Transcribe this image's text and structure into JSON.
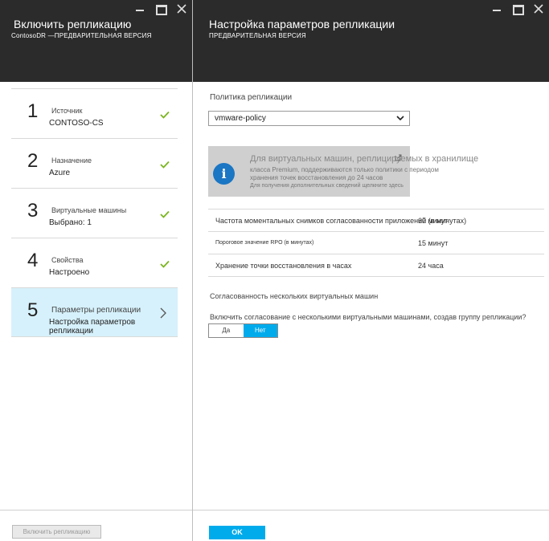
{
  "left_blade": {
    "title": "Включить репликацию",
    "subtitle": "ContosoDR —ПРЕДВАРИТЕЛЬНАЯ ВЕРСИЯ",
    "steps": [
      {
        "number": "1",
        "label": "Источник",
        "value": "CONTOSO-CS",
        "status": "checkmark-icon"
      },
      {
        "number": "2",
        "label": "Назначение",
        "value": "Azure",
        "status": "checkmark-icon"
      },
      {
        "number": "3",
        "label": "Виртуальные машины",
        "value": "Выбрано: 1",
        "status": "checkmark-icon"
      },
      {
        "number": "4",
        "label": "Свойства",
        "value": "Настроено",
        "status": "checkmark-icon"
      },
      {
        "number": "5",
        "label": "Параметры репликации",
        "value": "Настройка параметров репликации",
        "status": "chevron-right-icon"
      }
    ],
    "enable_button": "Включить репликацию"
  },
  "right_blade": {
    "title": "Настройка параметров репликации",
    "subtitle": "ПРЕДВАРИТЕЛЬНАЯ ВЕРСИЯ",
    "policy_label": "Политика репликации",
    "policy_value": "vmware-policy",
    "info": {
      "line1": "Для виртуальных машин, реплицируемых в хранилище",
      "line2": "класса Premium, поддерживаются только политики с периодом",
      "line3": "хранения точек восстановления до 24 часов",
      "line4": "Для получения дополнительных сведений щелкните здесь"
    },
    "policy_rows": [
      {
        "key": "Частота моментальных снимков согласованности приложений (в минутах)",
        "value": "60 минут"
      },
      {
        "key": "Пороговое значение RPO (в минутах)",
        "value": "15 минут"
      },
      {
        "key": "Хранение точки восстановления в часах",
        "value": "24 часа"
      }
    ],
    "multivm_label": "Согласованность нескольких виртуальных машин",
    "multivm_question": "Включить согласование с несколькими виртуальными машинами, создав группу репликации?",
    "toggle": {
      "yes": "Да",
      "no": "Нет",
      "selected": "Нет"
    },
    "ok_button": "OK"
  },
  "colors": {
    "header_bg": "#2b2b2b",
    "accent": "#00abec",
    "active_step_bg": "#d6f1fb",
    "check_green": "#7ab51d",
    "info_icon": "#1b76c4"
  }
}
